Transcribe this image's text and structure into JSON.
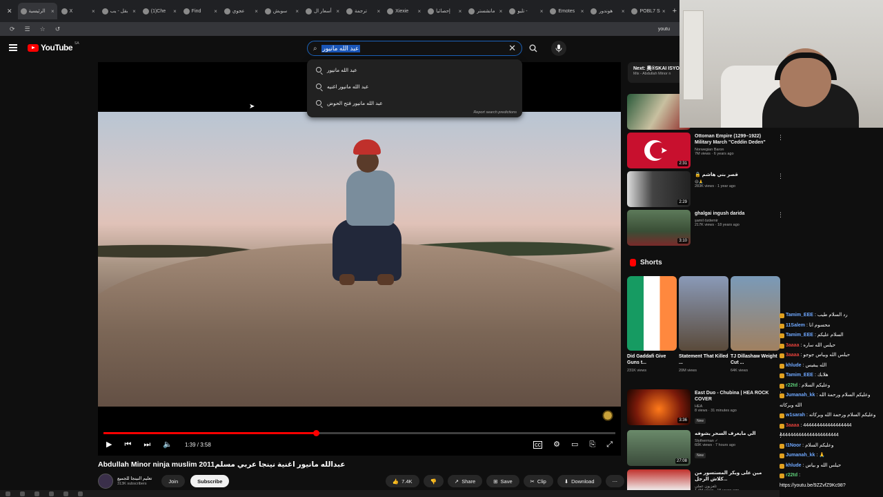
{
  "browser": {
    "tabs": [
      "الرئيسية",
      "X",
      "بقل - يب",
      "(1)Che",
      "Find",
      "عجوي",
      "سوبش",
      "أسعار ال",
      "ترجمة",
      "Xiexie",
      "إحصائيا",
      "مانشستر",
      "تليو -",
      "Emotes",
      "هوندور",
      "POBL7 S"
    ],
    "url": "youtu"
  },
  "header": {
    "logo": "YouTube",
    "country": "SA",
    "search_query": "عبد الله مانيور"
  },
  "suggestions": {
    "items": [
      "عبد الله مانيور",
      "عبد الله مانيور اغنيه",
      "عبد الله مانيور فتح الحوض"
    ],
    "report": "Report search predictions"
  },
  "player": {
    "time": "1:39 / 3:58",
    "progress": 0.415
  },
  "video": {
    "title": "Abdullah Minor ninja muslim 2011عبدالله مانيور اغنية نينجا عربي مسلم",
    "channel": "تعليم النينجا للجميع",
    "subs": "313K subscribers",
    "join": "Join",
    "subscribe": "Subscribe",
    "likes": "7.4K",
    "share": "Share",
    "save": "Save",
    "clip": "Clip",
    "download": "Download"
  },
  "sidebar": {
    "next_label": "Next: 奥®SKAI ISYO",
    "next_sub": "Mix - Abdullah Minor n",
    "videos": [
      {
        "title": "Ottoman Empire (1299–1922) Military March \"Ceddin Deden\"",
        "channel": "Norwegian Baron",
        "stats": "7M views · 6 years ago",
        "duration": "2:31"
      },
      {
        "title": "🔒 قصر بني هاشم",
        "channel": "😄🙏",
        "stats": "283K views · 1 year ago",
        "duration": "2:29"
      },
      {
        "title": "ghalgai ingush darida",
        "channel": "şamil özdemir",
        "stats": "217K views · 18 years ago",
        "duration": "3:10"
      }
    ],
    "shorts_label": "Shorts",
    "shorts": [
      {
        "title": "Did Gaddafi Give Guns t...",
        "views": "231K views"
      },
      {
        "title": "Statement That Killed ...",
        "views": "20M views"
      },
      {
        "title": "TJ Dillashaw Weight Cut ...",
        "views": "64K views"
      }
    ],
    "more": [
      {
        "title": "East Duo - Chubina | HEA ROCK COVER",
        "channel": "HEA",
        "stats": "8 views · 31 minutes ago",
        "badge": "New",
        "duration": "3:36"
      },
      {
        "title": "الي مايعرف السحر يشوفه",
        "channel": "Slytherman ✓",
        "stats": "60K views · 7 hours ago",
        "badge": "New",
        "duration": "27:08"
      },
      {
        "title": "مين على ويكر المستسور من كلاش الرجل...",
        "channel": "تلفزيون عملي",
        "stats": "1.4M views · 15 years ago",
        "badge": "",
        "duration": ""
      }
    ]
  },
  "chat": [
    {
      "user": "Tamim_EEE",
      "text": ": رد السلام طيب",
      "color": "#6fa8ff"
    },
    {
      "user": "11Salem",
      "text": ": محسوم انا",
      "color": "#6fa8ff"
    },
    {
      "user": "Tamim_EEE",
      "text": ": السلام عليكم",
      "color": "#6fa8ff"
    },
    {
      "user": "3aaaa",
      "text": ": حيلس الله ساره",
      "color": "#e0403a"
    },
    {
      "user": "3aaaa",
      "text": ": حيلس الله وبياس جوجو",
      "color": "#e0403a"
    },
    {
      "user": "khlude",
      "text": ": الله يبقيس",
      "color": "#6fa8ff"
    },
    {
      "user": "Tamim_EEE",
      "text": ": هلابك",
      "color": "#6fa8ff"
    },
    {
      "user": "r22td",
      "text": ": وعليكم السلام",
      "color": "#5fd17a"
    },
    {
      "user": "Jumanah_kk",
      "text": ": وعليكم السلام ورحمة الله",
      "color": "#6fa8ff"
    },
    {
      "user": "",
      "text": "الله وبركاته",
      "color": "#ffffff"
    },
    {
      "user": "w1sarah",
      "text": ": وعليكم السلام ورحمة الله وبركاته",
      "color": "#6fa8ff"
    },
    {
      "user": "3aaaa",
      "text": ": 444444444444444444",
      "color": "#e0403a"
    },
    {
      "user": "",
      "text": "4444444444444444444444",
      "color": "#ffffff"
    },
    {
      "user": "I1Noor",
      "text": ": وعليكم السلام",
      "color": "#6fa8ff"
    },
    {
      "user": "Jumanah_kk",
      "text": ": 🙏",
      "color": "#6fa8ff"
    },
    {
      "user": "khlude",
      "text": ": حيلس الله و بياس",
      "color": "#6fa8ff"
    },
    {
      "user": "r22td",
      "text": ":",
      "color": "#5fd17a"
    },
    {
      "user": "",
      "text": "https://youtu.be/9ZZvfZ9Kc98?",
      "color": "#ffffff"
    }
  ]
}
